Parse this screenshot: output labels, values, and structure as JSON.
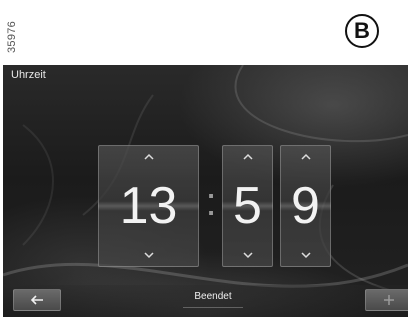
{
  "document": {
    "reference_number": "35976",
    "figure_badge": "B"
  },
  "screen": {
    "title": "Uhrzeit",
    "time": {
      "hours": "13",
      "separator": ":",
      "minutes_tens": "5",
      "minutes_ones": "9"
    },
    "buttons": {
      "back_icon": "left-arrow-icon",
      "done_label": "Beendet",
      "add_icon": "plus-icon"
    },
    "icons": {
      "up": "chevron-up-icon",
      "down": "chevron-down-icon"
    }
  }
}
